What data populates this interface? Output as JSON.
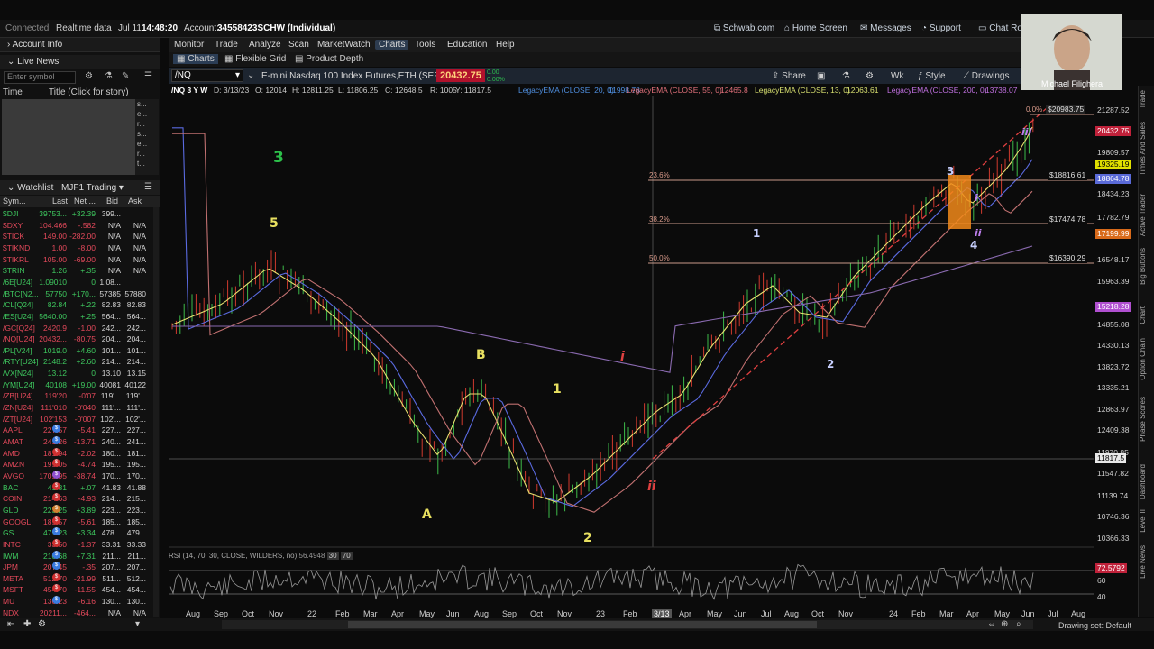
{
  "status": {
    "connection": "Connected",
    "data_mode": "Realtime data",
    "date": "Jul 11",
    "time": "14:48:20",
    "account_label": "Account:",
    "account": "34558423SCHW (Individual)",
    "links": [
      "Schwab.com",
      "Home Screen",
      "Messages",
      "Support",
      "Chat Ro"
    ]
  },
  "menu": [
    "Monitor",
    "Trade",
    "Analyze",
    "Scan",
    "MarketWatch",
    "Charts",
    "Tools",
    "Education",
    "Help"
  ],
  "submenu": [
    "Charts",
    "Flexible Grid",
    "Product Depth"
  ],
  "chart_toolbar": {
    "symbol": "/NQ",
    "description": "E-mini Nasdaq 100 Index Futures,ETH (SEP 24)",
    "last": "20432.75",
    "change_top": "0.00",
    "change_bottom": "0.00%",
    "tools": [
      "Share",
      "Wk",
      "Style",
      "Drawings"
    ]
  },
  "left_panel": {
    "account_info": "Account Info",
    "live_news": "Live News",
    "symbol_placeholder": "Enter symbol",
    "time_col": "Time",
    "title_col": "Title (Click for story)",
    "watchlist_tab": "Watchlist",
    "watchlist_name": "MJF1 Trading",
    "columns": [
      "Sym...",
      "Last",
      "Net ...",
      "Bid",
      "Ask"
    ],
    "rows": [
      {
        "sym": "$DJI",
        "last": "39753...",
        "net": "+32.39",
        "bid": "399...",
        "ask": "",
        "dir": "up"
      },
      {
        "sym": "$DXY",
        "last": "104.466",
        "net": "-.582",
        "bid": "N/A",
        "ask": "N/A",
        "dir": "dn"
      },
      {
        "sym": "$TICK",
        "last": "149.00",
        "net": "-282.00",
        "bid": "N/A",
        "ask": "N/A",
        "dir": "dn"
      },
      {
        "sym": "$TIKND",
        "last": "1.00",
        "net": "-8.00",
        "bid": "N/A",
        "ask": "N/A",
        "dir": "dn"
      },
      {
        "sym": "$TIKRL",
        "last": "105.00",
        "net": "-69.00",
        "bid": "N/A",
        "ask": "N/A",
        "dir": "dn"
      },
      {
        "sym": "$TRIN",
        "last": "1.26",
        "net": "+.35",
        "bid": "N/A",
        "ask": "N/A",
        "dir": "up"
      },
      {
        "sym": "/6E[U24]",
        "last": "1.09010",
        "net": "0",
        "bid": "1.08...",
        "ask": "",
        "dir": "up"
      },
      {
        "sym": "/BTC[N2...",
        "last": "57750",
        "net": "+170...",
        "bid": "57385",
        "ask": "57880",
        "dir": "up"
      },
      {
        "sym": "/CL[Q24]",
        "last": "82.84",
        "net": "+.22",
        "bid": "82.83",
        "ask": "82.83",
        "dir": "up"
      },
      {
        "sym": "/ES[U24]",
        "last": "5640.00",
        "net": "+.25",
        "bid": "564...",
        "ask": "564...",
        "dir": "up"
      },
      {
        "sym": "/GC[Q24]",
        "last": "2420.9",
        "net": "-1.00",
        "bid": "242...",
        "ask": "242...",
        "dir": "dn"
      },
      {
        "sym": "/NQ[U24]",
        "last": "20432...",
        "net": "-80.75",
        "bid": "204...",
        "ask": "204...",
        "dir": "dn"
      },
      {
        "sym": "/PL[V24]",
        "last": "1019.0",
        "net": "+4.60",
        "bid": "101...",
        "ask": "101...",
        "dir": "up"
      },
      {
        "sym": "/RTY[U24]",
        "last": "2148.2",
        "net": "+2.60",
        "bid": "214...",
        "ask": "214...",
        "dir": "up"
      },
      {
        "sym": "/VX[N24]",
        "last": "13.12",
        "net": "0",
        "bid": "13.10",
        "ask": "13.15",
        "dir": "up"
      },
      {
        "sym": "/YM[U24]",
        "last": "40108",
        "net": "+19.00",
        "bid": "40081",
        "ask": "40122",
        "dir": "up"
      },
      {
        "sym": "/ZB[U24]",
        "last": "119'20",
        "net": "-0'07",
        "bid": "119'...",
        "ask": "119'...",
        "dir": "dn"
      },
      {
        "sym": "/ZN[U24]",
        "last": "111'010",
        "net": "-0'040",
        "bid": "111'...",
        "ask": "111'...",
        "dir": "dn"
      },
      {
        "sym": "/ZT[U24]",
        "last": "102'153",
        "net": "-0'007",
        "bid": "102'...",
        "ask": "102'...",
        "dir": "dn"
      },
      {
        "sym": "AAPL",
        "last": "227.57",
        "net": "-5.41",
        "bid": "227...",
        "ask": "227...",
        "dir": "dn"
      },
      {
        "sym": "AMAT",
        "last": "241.26",
        "net": "-13.71",
        "bid": "240...",
        "ask": "241...",
        "dir": "dn"
      },
      {
        "sym": "AMD",
        "last": "181.94",
        "net": "-2.02",
        "bid": "180...",
        "ask": "181...",
        "dir": "dn"
      },
      {
        "sym": "AMZN",
        "last": "195.05",
        "net": "-4.74",
        "bid": "195...",
        "ask": "195...",
        "dir": "dn"
      },
      {
        "sym": "AVGO",
        "last": "1705.95",
        "net": "-38.74",
        "bid": "170...",
        "ask": "170...",
        "dir": "dn"
      },
      {
        "sym": "BAC",
        "last": "41.81",
        "net": "+.07",
        "bid": "41.83",
        "ask": "41.88",
        "dir": "up"
      },
      {
        "sym": "COIN",
        "last": "214.63",
        "net": "-4.93",
        "bid": "214...",
        "ask": "215...",
        "dir": "dn"
      },
      {
        "sym": "GLD",
        "last": "223.25",
        "net": "+3.89",
        "bid": "223...",
        "ask": "223...",
        "dir": "up"
      },
      {
        "sym": "GOOGL",
        "last": "185.57",
        "net": "-5.61",
        "bid": "185...",
        "ask": "185...",
        "dir": "dn"
      },
      {
        "sym": "GS",
        "last": "479.23",
        "net": "+3.34",
        "bid": "478...",
        "ask": "479...",
        "dir": "up"
      },
      {
        "sym": "INTC",
        "last": "33.50",
        "net": "-1.37",
        "bid": "33.31",
        "ask": "33.33",
        "dir": "dn"
      },
      {
        "sym": "IWM",
        "last": "210.68",
        "net": "+7.31",
        "bid": "211...",
        "ask": "211...",
        "dir": "up"
      },
      {
        "sym": "JPM",
        "last": "207.45",
        "net": "-.35",
        "bid": "207...",
        "ask": "207...",
        "dir": "dn"
      },
      {
        "sym": "META",
        "last": "512.70",
        "net": "-21.99",
        "bid": "511...",
        "ask": "512...",
        "dir": "dn"
      },
      {
        "sym": "MSFT",
        "last": "454.70",
        "net": "-11.55",
        "bid": "454...",
        "ask": "454...",
        "dir": "dn"
      },
      {
        "sym": "MU",
        "last": "130.23",
        "net": "-6.16",
        "bid": "130...",
        "ask": "130...",
        "dir": "dn"
      },
      {
        "sym": "NDX",
        "last": "20211...",
        "net": "-464...",
        "bid": "N/A",
        "ask": "N/A",
        "dir": "dn"
      }
    ]
  },
  "study_line": {
    "title": "/NQ 3 Y W",
    "date": "D: 3/13/23",
    "open": "O: 12014",
    "high": "H: 12811.25",
    "low": "L: 11806.25",
    "close": "C: 12648.5",
    "range": "R: 1005",
    "y": "Y: 11817.5",
    "ema20": "LegacyEMA (CLOSE, 20, 0)",
    "ema20v": "11998.78",
    "ema55": "LegacyEMA (CLOSE, 55, 0)",
    "ema55v": "12465.8",
    "ema13": "LegacyEMA (CLOSE, 13, 0)",
    "ema13v": "12063.61",
    "ema200": "LegacyEMA (CLOSE, 200, 0)",
    "ema200v": "13738.07"
  },
  "price_axis": [
    "21287.52",
    "19809.57",
    "18434.23",
    "17782.79",
    "16548.17",
    "15963.39",
    "14855.08",
    "14330.13",
    "13823.72",
    "13335.21",
    "12863.97",
    "12409.38",
    "11970.85",
    "11547.82",
    "11139.74",
    "10746.36",
    "10366.33"
  ],
  "price_tags": [
    {
      "label": "$20983.75",
      "color": "#222",
      "text": "#ddd"
    },
    {
      "label": "20432.75",
      "color": "#c0213a",
      "text": "#fff"
    },
    {
      "label": "19325.19",
      "color": "#e0e000",
      "text": "#000"
    },
    {
      "label": "18864.78",
      "color": "#5a6ad8",
      "text": "#fff"
    },
    {
      "label": "$18816.61",
      "color": "#0b0b0b",
      "text": "#ddd"
    },
    {
      "label": "$17474.78",
      "color": "#0b0b0b",
      "text": "#ddd"
    },
    {
      "label": "17199.99",
      "color": "#d86a1a",
      "text": "#fff"
    },
    {
      "label": "$16390.29",
      "color": "#0b0b0b",
      "text": "#ddd"
    },
    {
      "label": "15218.28",
      "color": "#b04fd0",
      "text": "#fff"
    },
    {
      "label": "11817.5",
      "color": "#e8e8e8",
      "text": "#000"
    }
  ],
  "fib_levels": [
    "0.0%",
    "23.6%",
    "38.2%",
    "50.0%"
  ],
  "wave_labels": [
    "3",
    "5",
    "B",
    "1",
    "A",
    "2",
    "i",
    "ii",
    "1",
    "2",
    "3",
    "4",
    "i",
    "ii",
    "iii"
  ],
  "rsi": {
    "header": "RSI (14, 70, 30, CLOSE, WILDERS, no)",
    "value": "56.4948",
    "ob": "30",
    "os": "70",
    "tag": "72.5792",
    "levels": [
      "60",
      "40"
    ]
  },
  "x_axis": [
    "Aug",
    "Sep",
    "Oct",
    "Nov",
    "22",
    "Feb",
    "Mar",
    "Apr",
    "May",
    "Jun",
    "Aug",
    "Sep",
    "Oct",
    "Nov",
    "23",
    "Feb",
    "3/13",
    "Apr",
    "May",
    "Jun",
    "Jul",
    "Aug",
    "Oct",
    "Nov",
    "24",
    "Feb",
    "Mar",
    "Apr",
    "May",
    "Jun",
    "Jul",
    "Aug"
  ],
  "right_rail": [
    "Trade",
    "Times And Sales",
    "Active Trader",
    "Big Buttons",
    "Chart",
    "Option Chain",
    "Phase Scores",
    "Dashboard",
    "Level II",
    "Live News"
  ],
  "webcam_name": "Michael Filighera",
  "drawing_set": "Drawing set: Default"
}
